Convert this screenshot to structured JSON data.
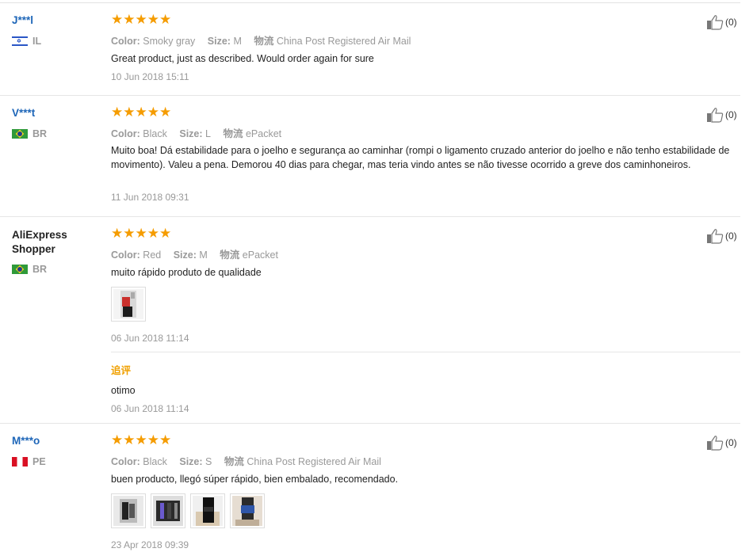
{
  "reviews": [
    {
      "user": "J***l",
      "country": "IL",
      "rating": "★★★★★",
      "color_label": "Color:",
      "color": "Smoky gray",
      "size_label": "Size:",
      "size": "M",
      "ship_label": "物流",
      "ship": "China Post Registered Air Mail",
      "text": "Great product, just as described. Would order again for sure",
      "date": "10 Jun 2018 15:11",
      "likes": "(0)"
    },
    {
      "user": "V***t",
      "country": "BR",
      "rating": "★★★★★",
      "color_label": "Color:",
      "color": "Black",
      "size_label": "Size:",
      "size": "L",
      "ship_label": "物流",
      "ship": "ePacket",
      "text": "Muito boa! Dá estabilidade para o joelho e segurança ao caminhar (rompi o ligamento cruzado anterior do joelho e não tenho estabilidade de movimento). Valeu a pena. Demorou 40 dias para chegar, mas teria vindo antes se não tivesse ocorrido a greve dos caminhoneiros.",
      "date": "11 Jun 2018 09:31",
      "likes": "(0)"
    },
    {
      "user": "AliExpress Shopper",
      "country": "BR",
      "rating": "★★★★★",
      "color_label": "Color:",
      "color": "Red",
      "size_label": "Size:",
      "size": "M",
      "ship_label": "物流",
      "ship": "ePacket",
      "text": "muito rápido produto de qualidade",
      "date": "06 Jun 2018 11:14",
      "followup_label": "追评",
      "followup_text": "otimo",
      "followup_date": "06 Jun 2018 11:14",
      "likes": "(0)"
    },
    {
      "user": "M***o",
      "country": "PE",
      "rating": "★★★★★",
      "color_label": "Color:",
      "color": "Black",
      "size_label": "Size:",
      "size": "S",
      "ship_label": "物流",
      "ship": "China Post Registered Air Mail",
      "text": "buen producto, llegó súper rápido, bien embalado, recomendado.",
      "date": "23 Apr 2018 09:39",
      "likes": "(0)"
    }
  ],
  "icons": {
    "like": "thumbs-up-icon",
    "flags": [
      "israel-flag-icon",
      "brazil-flag-icon",
      "peru-flag-icon"
    ]
  }
}
